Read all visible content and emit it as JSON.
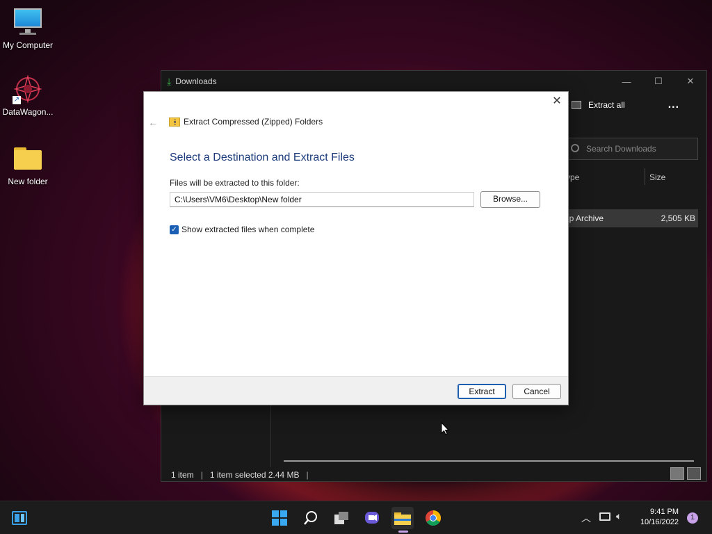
{
  "desktop": {
    "icons": [
      {
        "label": "My Computer"
      },
      {
        "label": "DataWagon..."
      },
      {
        "label": "New folder"
      }
    ]
  },
  "explorer": {
    "title": "Downloads",
    "extract_all": "Extract all",
    "more": "...",
    "search_placeholder": "Search Downloads",
    "col_type": "ype",
    "col_size": "Size",
    "row_type": "ip Archive",
    "row_size": "2,505 KB",
    "status_items": "1 item",
    "status_selected": "1 item selected  2.44 MB"
  },
  "dialog": {
    "header": "Extract Compressed (Zipped) Folders",
    "title": "Select a Destination and Extract Files",
    "subtitle": "Files will be extracted to this folder:",
    "path": "C:\\Users\\VM6\\Desktop\\New folder",
    "browse": "Browse...",
    "show_files": "Show extracted files when complete",
    "extract": "Extract",
    "cancel": "Cancel"
  },
  "taskbar": {
    "time": "9:41 PM",
    "date": "10/16/2022",
    "notifications": "1"
  }
}
